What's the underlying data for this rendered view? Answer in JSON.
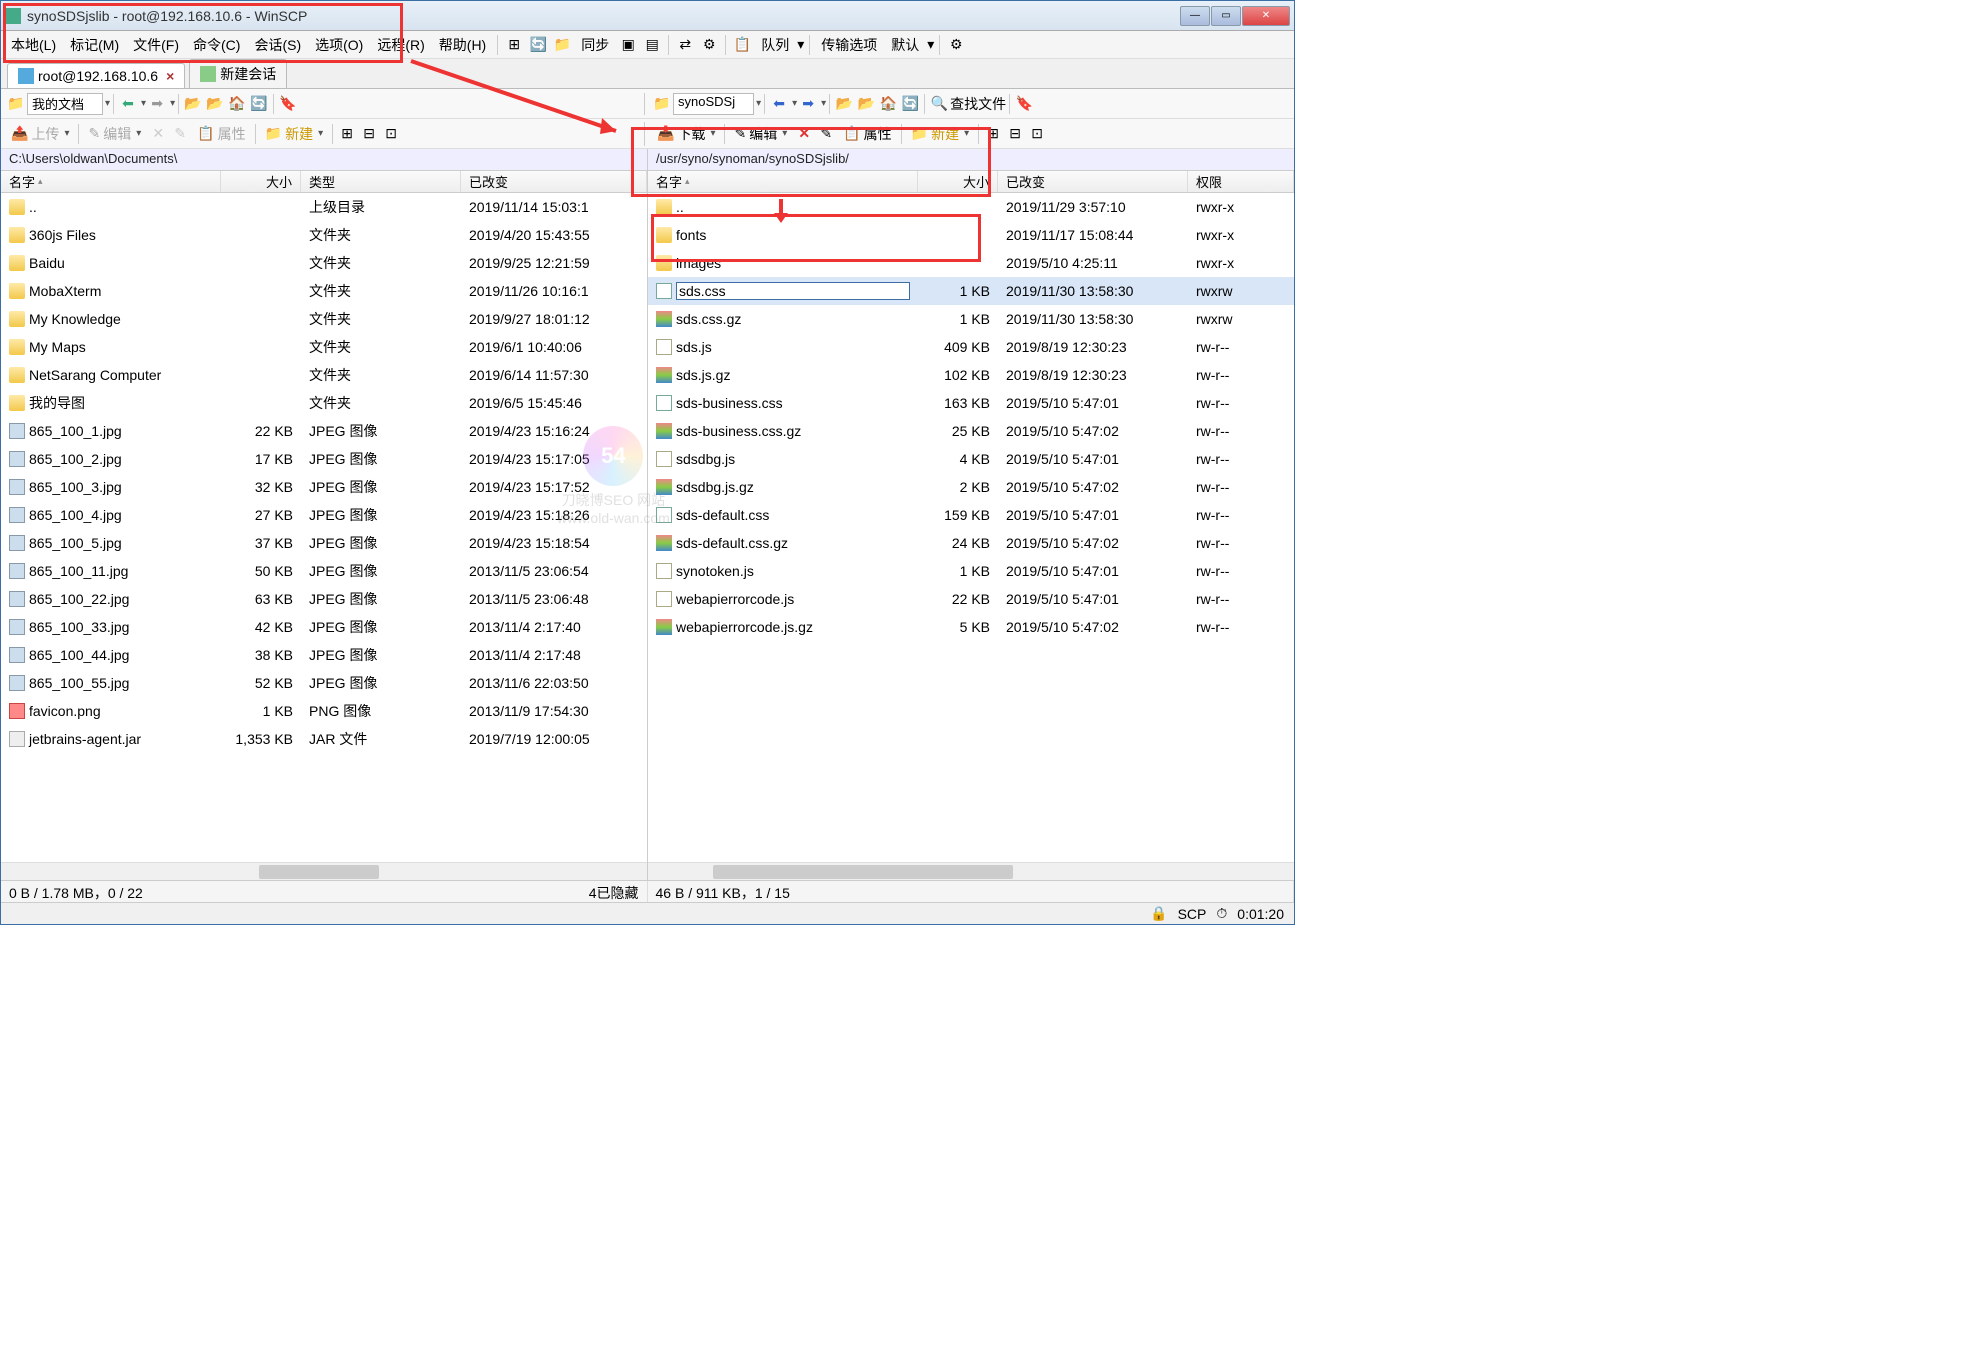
{
  "window": {
    "title": "synoSDSjslib - root@192.168.10.6 - WinSCP"
  },
  "menus": {
    "local": "本地(L)",
    "mark": "标记(M)",
    "file": "文件(F)",
    "command": "命令(C)",
    "session": "会话(S)",
    "options": "选项(O)",
    "remote": "远程(R)",
    "help": "帮助(H)",
    "sync": "同步",
    "queue": "队列",
    "transfer_opts": "传输选项",
    "default": "默认"
  },
  "tabs": {
    "session": "root@192.168.10.6",
    "new_session": "新建会话"
  },
  "left_toolbar": {
    "drive": "我的文档",
    "upload": "上传",
    "edit": "编辑",
    "props": "属性",
    "new": "新建"
  },
  "right_toolbar": {
    "drive": "synoSDSj",
    "download": "下载",
    "edit": "编辑",
    "props": "属性",
    "new": "新建",
    "find": "查找文件"
  },
  "left": {
    "path": "C:\\Users\\oldwan\\Documents\\",
    "cols": {
      "name": "名字",
      "size": "大小",
      "type": "类型",
      "changed": "已改变"
    },
    "rows": [
      {
        "icon": "up",
        "name": "..",
        "size": "",
        "type": "上级目录",
        "changed": "2019/11/14  15:03:1"
      },
      {
        "icon": "folder",
        "name": "360js Files",
        "size": "",
        "type": "文件夹",
        "changed": "2019/4/20  15:43:55"
      },
      {
        "icon": "folder",
        "name": "Baidu",
        "size": "",
        "type": "文件夹",
        "changed": "2019/9/25  12:21:59"
      },
      {
        "icon": "folder",
        "name": "MobaXterm",
        "size": "",
        "type": "文件夹",
        "changed": "2019/11/26  10:16:1"
      },
      {
        "icon": "folder",
        "name": "My Knowledge",
        "size": "",
        "type": "文件夹",
        "changed": "2019/9/27  18:01:12"
      },
      {
        "icon": "folder",
        "name": "My Maps",
        "size": "",
        "type": "文件夹",
        "changed": "2019/6/1  10:40:06"
      },
      {
        "icon": "folder",
        "name": "NetSarang Computer",
        "size": "",
        "type": "文件夹",
        "changed": "2019/6/14  11:57:30"
      },
      {
        "icon": "folder",
        "name": "我的导图",
        "size": "",
        "type": "文件夹",
        "changed": "2019/6/5  15:45:46"
      },
      {
        "icon": "img",
        "name": "865_100_1.jpg",
        "size": "22 KB",
        "type": "JPEG 图像",
        "changed": "2019/4/23  15:16:24"
      },
      {
        "icon": "img",
        "name": "865_100_2.jpg",
        "size": "17 KB",
        "type": "JPEG 图像",
        "changed": "2019/4/23  15:17:05"
      },
      {
        "icon": "img",
        "name": "865_100_3.jpg",
        "size": "32 KB",
        "type": "JPEG 图像",
        "changed": "2019/4/23  15:17:52"
      },
      {
        "icon": "img",
        "name": "865_100_4.jpg",
        "size": "27 KB",
        "type": "JPEG 图像",
        "changed": "2019/4/23  15:18:26"
      },
      {
        "icon": "img",
        "name": "865_100_5.jpg",
        "size": "37 KB",
        "type": "JPEG 图像",
        "changed": "2019/4/23  15:18:54"
      },
      {
        "icon": "img",
        "name": "865_100_11.jpg",
        "size": "50 KB",
        "type": "JPEG 图像",
        "changed": "2013/11/5  23:06:54"
      },
      {
        "icon": "img",
        "name": "865_100_22.jpg",
        "size": "63 KB",
        "type": "JPEG 图像",
        "changed": "2013/11/5  23:06:48"
      },
      {
        "icon": "img",
        "name": "865_100_33.jpg",
        "size": "42 KB",
        "type": "JPEG 图像",
        "changed": "2013/11/4  2:17:40"
      },
      {
        "icon": "img",
        "name": "865_100_44.jpg",
        "size": "38 KB",
        "type": "JPEG 图像",
        "changed": "2013/11/4  2:17:48"
      },
      {
        "icon": "img",
        "name": "865_100_55.jpg",
        "size": "52 KB",
        "type": "JPEG 图像",
        "changed": "2013/11/6  22:03:50"
      },
      {
        "icon": "png",
        "name": "favicon.png",
        "size": "1 KB",
        "type": "PNG 图像",
        "changed": "2013/11/9  17:54:30"
      },
      {
        "icon": "jar",
        "name": "jetbrains-agent.jar",
        "size": "1,353 KB",
        "type": "JAR 文件",
        "changed": "2019/7/19  12:00:05"
      }
    ]
  },
  "right": {
    "path": "/usr/syno/synoman/synoSDSjslib/",
    "cols": {
      "name": "名字",
      "size": "大小",
      "changed": "已改变",
      "perm": "权限"
    },
    "selected_index": 3,
    "editing": "sds.css",
    "rows": [
      {
        "icon": "up",
        "name": "..",
        "size": "",
        "changed": "2019/11/29 3:57:10",
        "perm": "rwxr-x"
      },
      {
        "icon": "folder",
        "name": "fonts",
        "size": "",
        "changed": "2019/11/17 15:08:44",
        "perm": "rwxr-x"
      },
      {
        "icon": "folder",
        "name": "images",
        "size": "",
        "changed": "2019/5/10 4:25:11",
        "perm": "rwxr-x"
      },
      {
        "icon": "css",
        "name": "sds.css",
        "size": "1 KB",
        "changed": "2019/11/30 13:58:30",
        "perm": "rwxrw"
      },
      {
        "icon": "gz",
        "name": "sds.css.gz",
        "size": "1 KB",
        "changed": "2019/11/30 13:58:30",
        "perm": "rwxrw"
      },
      {
        "icon": "js",
        "name": "sds.js",
        "size": "409 KB",
        "changed": "2019/8/19 12:30:23",
        "perm": "rw-r--"
      },
      {
        "icon": "gz",
        "name": "sds.js.gz",
        "size": "102 KB",
        "changed": "2019/8/19 12:30:23",
        "perm": "rw-r--"
      },
      {
        "icon": "css",
        "name": "sds-business.css",
        "size": "163 KB",
        "changed": "2019/5/10 5:47:01",
        "perm": "rw-r--"
      },
      {
        "icon": "gz",
        "name": "sds-business.css.gz",
        "size": "25 KB",
        "changed": "2019/5/10 5:47:02",
        "perm": "rw-r--"
      },
      {
        "icon": "js",
        "name": "sdsdbg.js",
        "size": "4 KB",
        "changed": "2019/5/10 5:47:01",
        "perm": "rw-r--"
      },
      {
        "icon": "gz",
        "name": "sdsdbg.js.gz",
        "size": "2 KB",
        "changed": "2019/5/10 5:47:02",
        "perm": "rw-r--"
      },
      {
        "icon": "css",
        "name": "sds-default.css",
        "size": "159 KB",
        "changed": "2019/5/10 5:47:01",
        "perm": "rw-r--"
      },
      {
        "icon": "gz",
        "name": "sds-default.css.gz",
        "size": "24 KB",
        "changed": "2019/5/10 5:47:02",
        "perm": "rw-r--"
      },
      {
        "icon": "js",
        "name": "synotoken.js",
        "size": "1 KB",
        "changed": "2019/5/10 5:47:01",
        "perm": "rw-r--"
      },
      {
        "icon": "js",
        "name": "webapierrorcode.js",
        "size": "22 KB",
        "changed": "2019/5/10 5:47:01",
        "perm": "rw-r--"
      },
      {
        "icon": "gz",
        "name": "webapierrorcode.js.gz",
        "size": "5 KB",
        "changed": "2019/5/10 5:47:02",
        "perm": "rw-r--"
      }
    ]
  },
  "status": {
    "left": "0 B / 1.78 MB，0 / 22",
    "left_hidden": "4已隐藏",
    "right": "46 B / 911 KB，1 / 15"
  },
  "bottom": {
    "protocol": "SCP",
    "time": "0:01:20"
  },
  "watermark": {
    "initials": "54",
    "text1": "www.old-wan.com",
    "text2": "刀晓博SEO 网站"
  }
}
